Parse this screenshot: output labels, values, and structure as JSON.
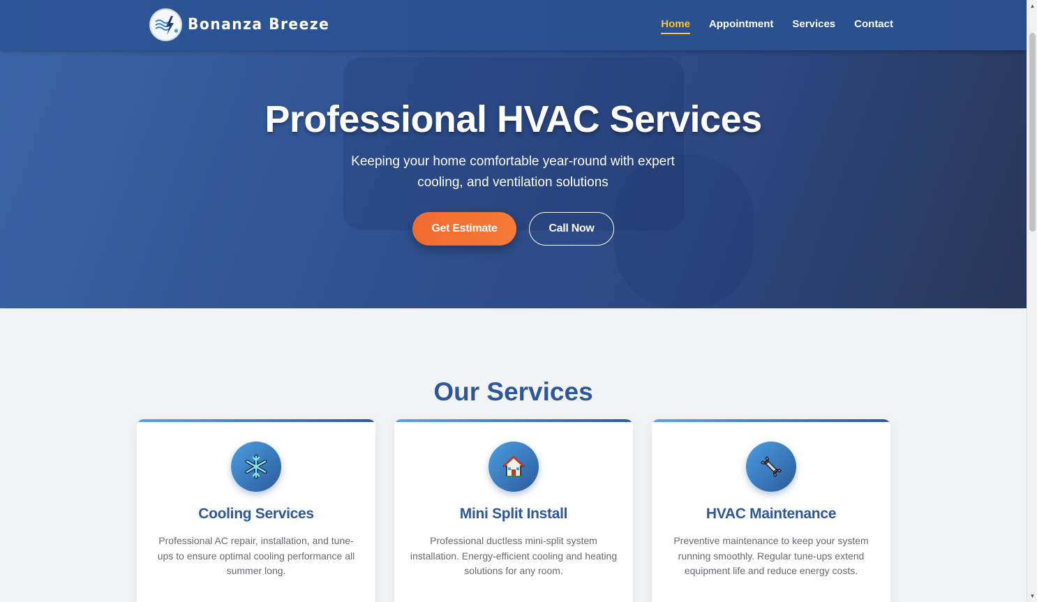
{
  "brand": {
    "name": "Bonanza Breeze",
    "logo_icon": "wind-lightning-logo"
  },
  "nav": {
    "items": [
      {
        "label": "Home",
        "active": true
      },
      {
        "label": "Appointment",
        "active": false
      },
      {
        "label": "Services",
        "active": false
      },
      {
        "label": "Contact",
        "active": false
      }
    ]
  },
  "hero": {
    "title": "Professional HVAC Services",
    "subtitle": "Keeping your home comfortable year-round with expert cooling, and ventilation solutions",
    "primary_button": "Get Estimate",
    "secondary_button": "Call Now"
  },
  "services": {
    "heading": "Our Services",
    "cards": [
      {
        "icon": "snowflake-icon",
        "title": "Cooling Services",
        "text": "Professional AC repair, installation, and tune-ups to ensure optimal cooling performance all summer long."
      },
      {
        "icon": "house-icon",
        "title": "Mini Split Install",
        "text": "Professional ductless mini-split system installation. Energy-efficient cooling and heating solutions for any room."
      },
      {
        "icon": "wrench-icon",
        "title": "HVAC Maintenance",
        "text": "Preventive maintenance to keep your system running smoothly. Regular tune-ups extend equipment life and reduce energy costs."
      }
    ]
  },
  "colors": {
    "header_bg": "#2c5597",
    "accent_active": "#f5c832",
    "cta_orange": "#f26a2f",
    "heading_blue": "#2d5799"
  }
}
